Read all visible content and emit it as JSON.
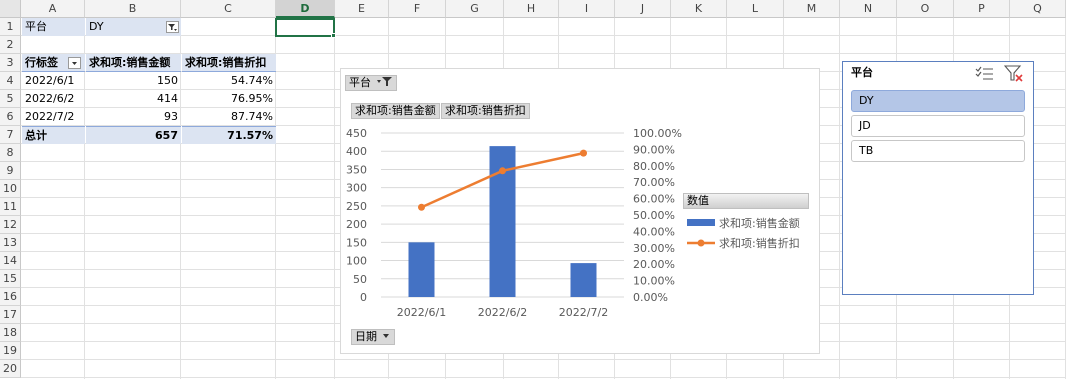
{
  "sheet": {
    "columns": [
      "A",
      "B",
      "C",
      "D",
      "E",
      "F",
      "G",
      "H",
      "I",
      "J",
      "K",
      "L",
      "M",
      "N",
      "O",
      "P",
      "Q"
    ],
    "rows": [
      "1",
      "2",
      "3",
      "4",
      "5",
      "6",
      "7",
      "8",
      "9",
      "10",
      "11",
      "12",
      "13",
      "14",
      "15",
      "16",
      "17",
      "18",
      "19",
      "20"
    ],
    "selected_column": "D"
  },
  "pivot": {
    "filter_label": "平台",
    "filter_value": "DY",
    "header": [
      "行标签",
      "求和项:销售金额",
      "求和项:销售折扣"
    ],
    "rows": [
      {
        "label": "2022/6/1",
        "amount": "150",
        "discount": "54.74%"
      },
      {
        "label": "2022/6/2",
        "amount": "414",
        "discount": "76.95%"
      },
      {
        "label": "2022/7/2",
        "amount": "93",
        "discount": "87.74%"
      }
    ],
    "total": {
      "label": "总计",
      "amount": "657",
      "discount": "71.57%"
    }
  },
  "chart_buttons": {
    "filter": "平台",
    "value1": "求和项:销售金额",
    "value2": "求和项:销售折扣",
    "axis": "日期",
    "legend_title": "数值"
  },
  "chart_data": {
    "type": "bar",
    "categories": [
      "2022/6/1",
      "2022/6/2",
      "2022/7/2"
    ],
    "series": [
      {
        "name": "求和项:销售金额",
        "type": "bar",
        "axis": "left",
        "values": [
          150,
          414,
          93
        ],
        "color": "#4472c4"
      },
      {
        "name": "求和项:销售折扣",
        "type": "line",
        "axis": "right",
        "values": [
          54.74,
          76.95,
          87.74
        ],
        "color": "#ed7d31"
      }
    ],
    "left_axis": {
      "ylim": [
        0,
        450
      ],
      "ticks": [
        "0",
        "50",
        "100",
        "150",
        "200",
        "250",
        "300",
        "350",
        "400",
        "450"
      ]
    },
    "right_axis": {
      "ylim": [
        0,
        100
      ],
      "ticks": [
        "0.00%",
        "10.00%",
        "20.00%",
        "30.00%",
        "40.00%",
        "50.00%",
        "60.00%",
        "70.00%",
        "80.00%",
        "90.00%",
        "100.00%"
      ]
    },
    "grid": true,
    "legend_position": "right"
  },
  "slicer": {
    "title": "平台",
    "items": [
      {
        "label": "DY",
        "selected": true
      },
      {
        "label": "JD",
        "selected": false
      },
      {
        "label": "TB",
        "selected": false
      }
    ]
  }
}
